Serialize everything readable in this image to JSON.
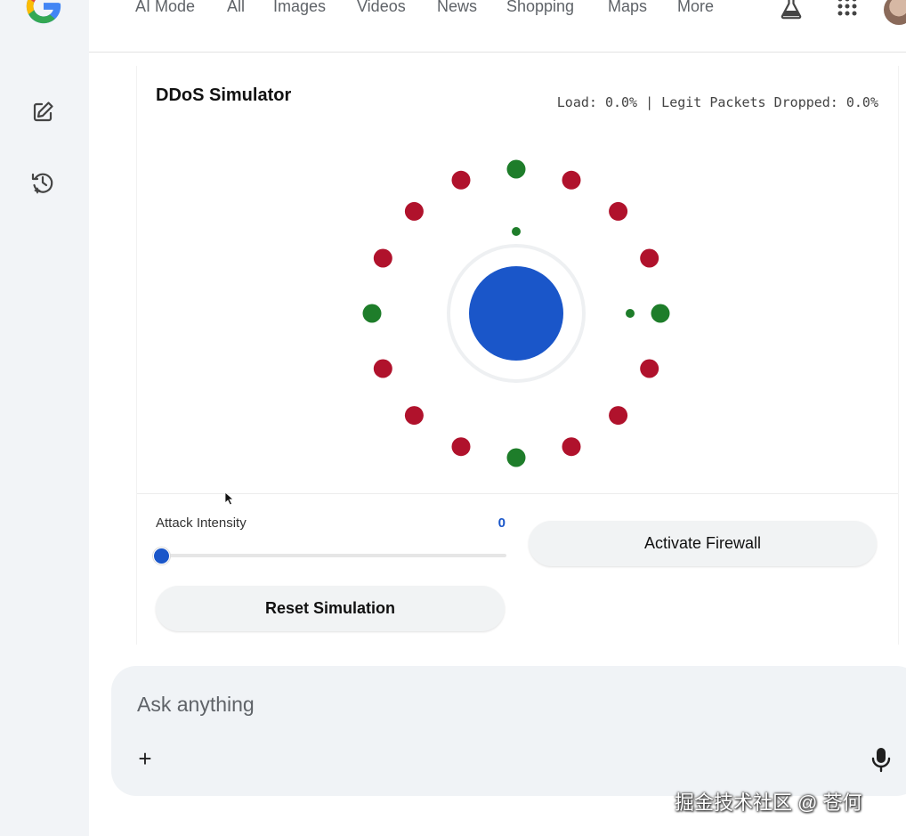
{
  "nav": {
    "tabs": [
      "AI Mode",
      "All",
      "Images",
      "Videos",
      "News",
      "Shopping",
      "Maps",
      "More"
    ],
    "icons": [
      "labs-flask-icon",
      "apps-grid-icon",
      "avatar"
    ]
  },
  "sidebar": {
    "icons": [
      "new-chat-edit-icon",
      "history-icon"
    ]
  },
  "simulator": {
    "title": "DDoS Simulator",
    "stats": "Load: 0.0% | Legit Packets Dropped: 0.0%",
    "attack_intensity_label": "Attack Intensity",
    "attack_intensity_value": "0",
    "intensity": 0,
    "firewall_button": "Activate Firewall",
    "reset_button": "Reset Simulation",
    "server_color": "#1a56c9",
    "nodes": [
      {
        "type": "legit"
      },
      {
        "type": "attacker"
      },
      {
        "type": "attacker"
      },
      {
        "type": "attacker"
      },
      {
        "type": "legit"
      },
      {
        "type": "attacker"
      },
      {
        "type": "attacker"
      },
      {
        "type": "attacker"
      },
      {
        "type": "legit"
      },
      {
        "type": "attacker"
      },
      {
        "type": "attacker"
      },
      {
        "type": "attacker"
      },
      {
        "type": "legit"
      },
      {
        "type": "attacker"
      },
      {
        "type": "attacker"
      },
      {
        "type": "attacker"
      }
    ],
    "colors": {
      "legit": "#1e7d2a",
      "attacker": "#b0122c"
    }
  },
  "ask": {
    "placeholder": "Ask anything",
    "value": ""
  },
  "watermark": "掘金技术社区 @ 苍何"
}
